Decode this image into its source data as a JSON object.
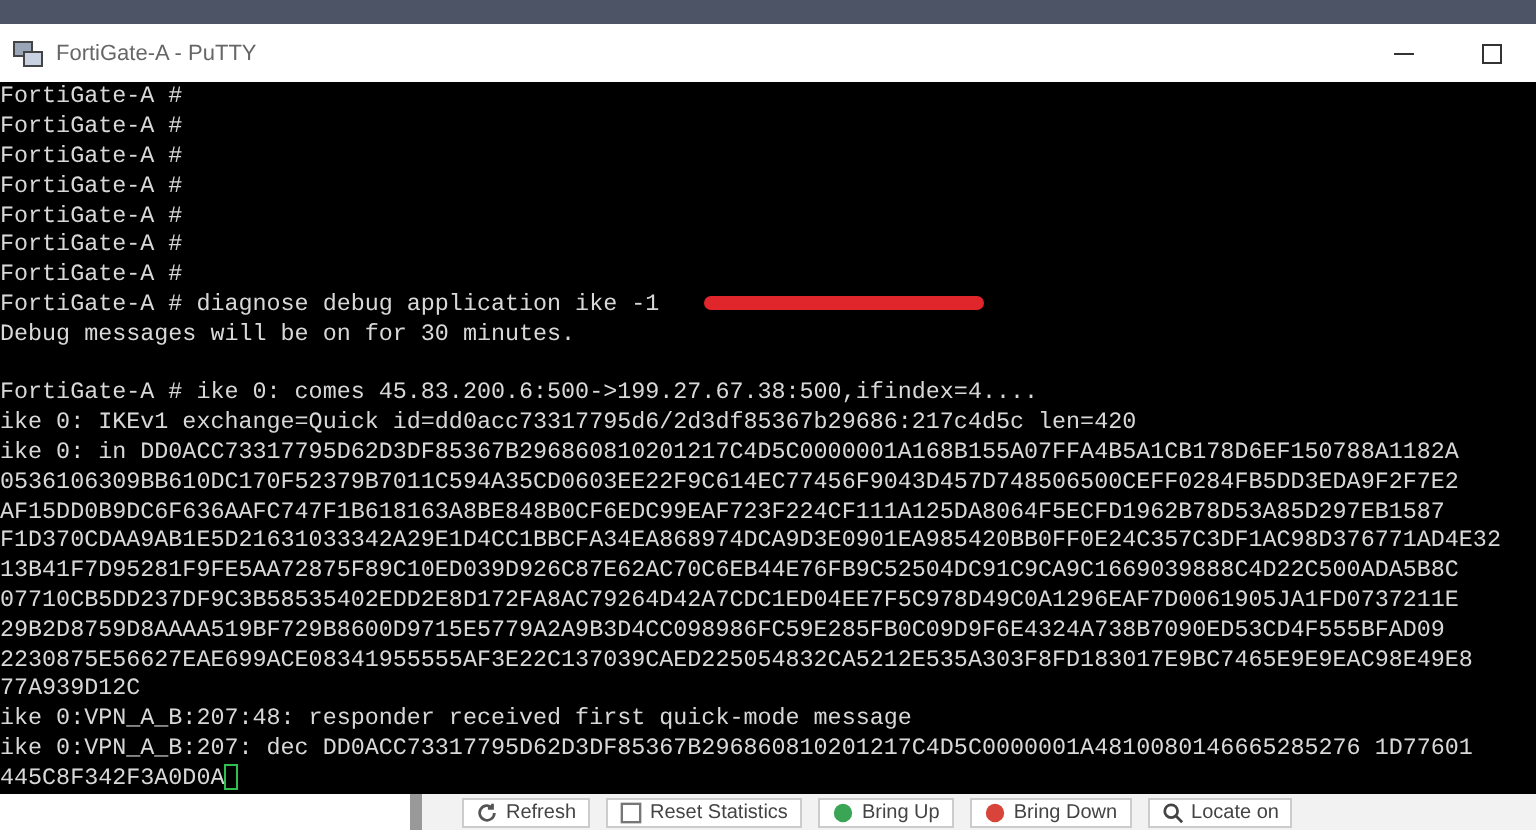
{
  "window": {
    "title": "FortiGate-A - PuTTY"
  },
  "terminal": {
    "cursor_visible": true,
    "lines": [
      {
        "kind": "text",
        "text": "FortiGate-A #",
        "marked": false
      },
      {
        "kind": "text",
        "text": "FortiGate-A #",
        "marked": false
      },
      {
        "kind": "text",
        "text": "FortiGate-A #",
        "marked": false
      },
      {
        "kind": "text",
        "text": "FortiGate-A #",
        "marked": false
      },
      {
        "kind": "text",
        "text": "FortiGate-A #",
        "marked": false
      },
      {
        "kind": "text",
        "text": "FortiGate-A #",
        "marked": false
      },
      {
        "kind": "text",
        "text": "FortiGate-A #",
        "marked": false
      },
      {
        "kind": "text",
        "text": "FortiGate-A # diagnose debug application ike -1",
        "marked": true
      },
      {
        "kind": "text",
        "text": "Debug messages will be on for 30 minutes.",
        "marked": false
      },
      {
        "kind": "blank"
      },
      {
        "kind": "text",
        "text": "FortiGate-A # ike 0: comes 45.83.200.6:500->199.27.67.38:500,ifindex=4....",
        "marked": false
      },
      {
        "kind": "text",
        "text": "ike 0: IKEv1 exchange=Quick id=dd0acc73317795d6/2d3df85367b29686:217c4d5c len=420",
        "marked": false
      },
      {
        "kind": "text",
        "text": "ike 0: in DD0ACC73317795D62D3DF85367B296860810201217C4D5C0000001A168B155A07FFA4B5A1CB178D6EF150788A1182A",
        "marked": false
      },
      {
        "kind": "text",
        "text": "0536106309BB610DC170F52379B7011C594A35CD0603EE22F9C614EC77456F9043D457D748506500CEFF0284FB5DD3EDA9F2F7E2",
        "marked": false
      },
      {
        "kind": "text",
        "text": "AF15DD0B9DC6F636AAFC747F1B618163A8BE848B0CF6EDC99EAF723F224CF111A125DA8064F5ECFD1962B78D53A85D297EB1587",
        "marked": false
      },
      {
        "kind": "text",
        "text": "F1D370CDAA9AB1E5D21631033342A29E1D4CC1BBCFA34EA868974DCA9D3E0901EA985420BB0FF0E24C357C3DF1AC98D376771AD4E32",
        "marked": false
      },
      {
        "kind": "text",
        "text": "13B41F7D95281F9FE5AA72875F89C10ED039D926C87E62AC70C6EB44E76FB9C52504DC91C9CA9C1669039888C4D22C500ADA5B8C",
        "marked": false
      },
      {
        "kind": "text",
        "text": "07710CB5DD237DF9C3B58535402EDD2E8D172FA8AC79264D42A7CDC1ED04EE7F5C978D49C0A1296EAF7D0061905JA1FD0737211E",
        "marked": false
      },
      {
        "kind": "text",
        "text": "29B2D8759D8AAAA519BF729B8600D9715E5779A2A9B3D4CC098986FC59E285FB0C09D9F6E4324A738B7090ED53CD4F555BFAD09",
        "marked": false
      },
      {
        "kind": "text",
        "text": "2230875E56627EAE699ACE08341955555AF3E22C137039CAED225054832CA5212E535A303F8FD183017E9BC7465E9E9EAC98E49E8",
        "marked": false
      },
      {
        "kind": "text",
        "text": "77A939D12C",
        "marked": false
      },
      {
        "kind": "text",
        "text": "ike 0:VPN_A_B:207:48: responder received first quick-mode message",
        "marked": false
      },
      {
        "kind": "text",
        "text": "ike 0:VPN_A_B:207: dec DD0ACC73317795D62D3DF85367B296860810201217C4D5C0000001A4810080146665285276 1D77601",
        "marked": false
      },
      {
        "kind": "text",
        "text": "445C8F342F3A0D0A",
        "marked": false
      }
    ]
  },
  "background_toolbar": {
    "buttons": [
      {
        "kind": "refresh",
        "label": "Refresh"
      },
      {
        "kind": "reset",
        "label": "Reset Statistics"
      },
      {
        "kind": "up",
        "label": "Bring Up"
      },
      {
        "kind": "down",
        "label": "Bring Down"
      },
      {
        "kind": "locate",
        "label": "Locate on"
      }
    ]
  }
}
